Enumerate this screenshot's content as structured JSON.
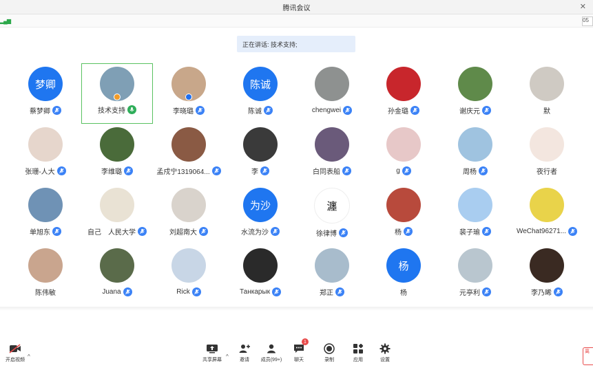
{
  "window": {
    "title": "腾讯会议",
    "close_glyph": "✕"
  },
  "info_bar": {
    "signal_glyph": "▂▄▆",
    "timer_text": "05"
  },
  "speaking": {
    "text": "正在讲话: 技术支持;"
  },
  "participants": [
    {
      "name": "蔡梦卿",
      "avatar_text": "梦卿",
      "avatar_color": "#1f76f0",
      "mic": "muted"
    },
    {
      "name": "技术支持",
      "avatar_text": "",
      "avatar_color": "#7f9fb5",
      "mic": "speaking",
      "active": true,
      "badge": "orange"
    },
    {
      "name": "李晓璐",
      "avatar_text": "",
      "avatar_color": "#c8a78a",
      "mic": "muted",
      "badge": "blue"
    },
    {
      "name": "陈诚",
      "avatar_text": "陈诚",
      "avatar_color": "#1f76f0",
      "mic": "muted"
    },
    {
      "name": "chengwei",
      "avatar_text": "",
      "avatar_color": "#8e9190",
      "mic": "muted"
    },
    {
      "name": "孙金璐",
      "avatar_text": "",
      "avatar_color": "#c8262c",
      "mic": "muted"
    },
    {
      "name": "谢庆元",
      "avatar_text": "",
      "avatar_color": "#5f8a4a",
      "mic": "muted"
    },
    {
      "name": "默",
      "avatar_text": "",
      "avatar_color": "#cfcac3",
      "mic": "none"
    },
    {
      "name": "张珊-人大",
      "avatar_text": "",
      "avatar_color": "#e6d6cc",
      "mic": "muted"
    },
    {
      "name": "李维璐",
      "avatar_text": "",
      "avatar_color": "#4a6b3a",
      "mic": "muted"
    },
    {
      "name": "孟戍宁1319064...",
      "avatar_text": "",
      "avatar_color": "#8a5a44",
      "mic": "muted"
    },
    {
      "name": "李",
      "avatar_text": "",
      "avatar_color": "#3a3a3a",
      "mic": "muted"
    },
    {
      "name": "白同表船",
      "avatar_text": "",
      "avatar_color": "#6a5a7a",
      "mic": "muted"
    },
    {
      "name": "g",
      "avatar_text": "",
      "avatar_color": "#e7c8c8",
      "mic": "muted"
    },
    {
      "name": "周杨",
      "avatar_text": "",
      "avatar_color": "#9fc3e0",
      "mic": "muted"
    },
    {
      "name": "夜行者",
      "avatar_text": "",
      "avatar_color": "#f3e6df",
      "mic": "none"
    },
    {
      "name": "单旭东",
      "avatar_text": "",
      "avatar_color": "#6f92b5",
      "mic": "muted"
    },
    {
      "name": "自己　人民大学",
      "avatar_text": "",
      "avatar_color": "#e9e2d4",
      "mic": "muted"
    },
    {
      "name": "刘超南大",
      "avatar_text": "",
      "avatar_color": "#d9d3cc",
      "mic": "muted"
    },
    {
      "name": "水流为沙",
      "avatar_text": "为沙",
      "avatar_color": "#1f76f0",
      "mic": "muted"
    },
    {
      "name": "徐律博",
      "avatar_text": "瀍",
      "avatar_color": "#ffffff",
      "avatar_text_color": "#111111",
      "mic": "muted"
    },
    {
      "name": "杨",
      "avatar_text": "",
      "avatar_color": "#b84a3c",
      "mic": "muted"
    },
    {
      "name": "裴子瑜",
      "avatar_text": "",
      "avatar_color": "#a9cdf0",
      "mic": "muted"
    },
    {
      "name": "WeChat96271...",
      "avatar_text": "",
      "avatar_color": "#e9d34a",
      "mic": "muted"
    },
    {
      "name": "陈伟敏",
      "avatar_text": "",
      "avatar_color": "#c9a58e",
      "mic": "none"
    },
    {
      "name": "Juana",
      "avatar_text": "",
      "avatar_color": "#5a6b4a",
      "mic": "muted"
    },
    {
      "name": "Rick",
      "avatar_text": "",
      "avatar_color": "#c8d6e6",
      "mic": "muted"
    },
    {
      "name": "Танкарык",
      "avatar_text": "",
      "avatar_color": "#2a2a2a",
      "mic": "muted"
    },
    {
      "name": "郑正",
      "avatar_text": "",
      "avatar_color": "#a8bccc",
      "mic": "muted"
    },
    {
      "name": "杨",
      "avatar_text": "杨",
      "avatar_color": "#1f76f0",
      "mic": "none"
    },
    {
      "name": "元亭利",
      "avatar_text": "",
      "avatar_color": "#b9c6cf",
      "mic": "muted"
    },
    {
      "name": "李乃晞",
      "avatar_text": "",
      "avatar_color": "#3a2a22",
      "mic": "muted"
    }
  ],
  "toolbar": {
    "video_label": "开启视频",
    "share_label": "共享屏幕",
    "invite_label": "邀请",
    "members_label": "成员(99+)",
    "chat_label": "聊天",
    "chat_badge": "1",
    "record_label": "录制",
    "apps_label": "应用",
    "settings_label": "设置",
    "leave_label": "离"
  }
}
